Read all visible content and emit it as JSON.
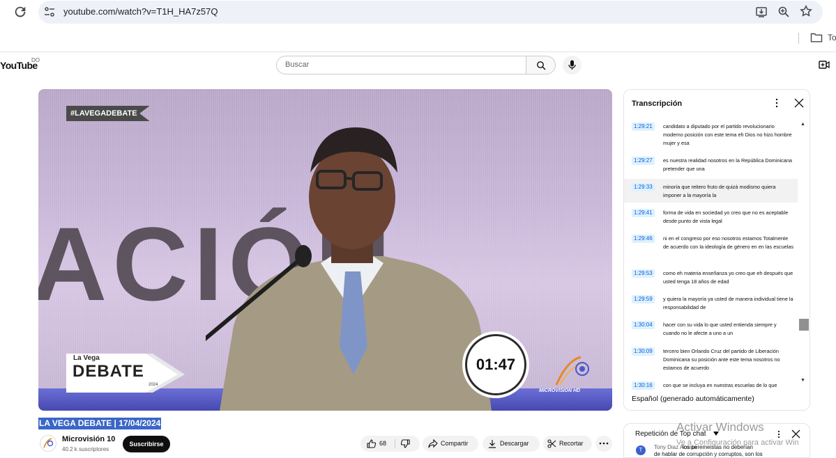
{
  "browser": {
    "url": "youtube.com/watch?v=T1H_HA7z57Q",
    "bookmark_label": "To"
  },
  "header": {
    "logo": "YouTube",
    "logo_superscript": "DO",
    "search_placeholder": "Buscar"
  },
  "video": {
    "hashtag": "#LAVEGADEBATE",
    "background_word": "ACIÓN",
    "logo_small": "La Vega",
    "logo_big": "DEBATE",
    "logo_year": "2024",
    "timer": "01:47",
    "channel_bug": "MICROVISION HD"
  },
  "meta": {
    "title": "LA VEGA DEBATE | 17/04/2024",
    "channel_name": "Microvisión 10",
    "subscribers": "40.2 k suscriptores",
    "subscribe": "Suscribirse",
    "likes": "68",
    "share": "Compartir",
    "download": "Descargar",
    "clip": "Recortar"
  },
  "transcript": {
    "title": "Transcripción",
    "language": "Español (generado automáticamente)",
    "segments": [
      {
        "time": "1:29:21",
        "text": "candidato a diputado por el partido revolucionario moderno posición con este tema eh Dios no hizo hombre mujer y esa"
      },
      {
        "time": "1:29:27",
        "text": "es nuestra realidad nosotros en la República Dominicana pretender que una"
      },
      {
        "time": "1:29:33",
        "text": "minoría que reitero fruto de quizá modismo quiera imponer a la mayoría la"
      },
      {
        "time": "1:29:41",
        "text": "forma de vida en sociedad yo creo que no es aceptable desde punto de vista legal"
      },
      {
        "time": "1:29:46",
        "text": "ni en el congreso por eso nosotros estamos Totalmente de acuerdo con la ideología de género en en las escuelas"
      },
      {
        "time": "1:29:53",
        "text": "como eh materia enseñanza yo creo que eh después que usted tenga 18 años de edad"
      },
      {
        "time": "1:29:59",
        "text": "y quiera la mayoría ya usted de manera individual tiene la responsabilidad de"
      },
      {
        "time": "1:30:04",
        "text": "hacer con su vida lo que usted entienda siempre y cuando no le afecte a uno a un"
      },
      {
        "time": "1:30:09",
        "text": "tercero bien Orlando Cruz del partido de Liberación Dominicana su posición ante este tema nosotros no estamos de acuerdo"
      },
      {
        "time": "1:30:16",
        "text": "con que se incluya en nuestras escuelas de lo que"
      }
    ]
  },
  "chat": {
    "title": "Repetición de Top chat",
    "avatar_letter": "T",
    "author": "Tony Diaz Acosta",
    "message_line1": "los peremeistas no deberían",
    "message_line2": "de hablar de corrupción y corruptos, son los"
  },
  "watermark": {
    "title": "Activar Windows",
    "subtitle": "Ve a Configuración para activar Win"
  }
}
